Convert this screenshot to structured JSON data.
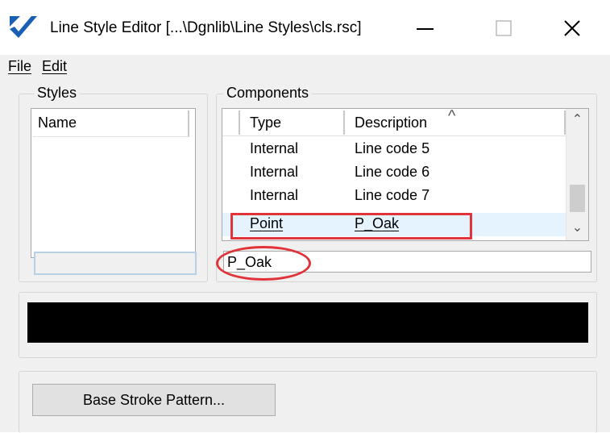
{
  "window": {
    "title": "Line Style Editor [...\\Dgnlib\\Line Styles\\cls.rsc]",
    "minimize_icon": "minimize-icon",
    "maximize_icon": "maximize-icon",
    "close_icon": "close-icon"
  },
  "menu": {
    "items": [
      {
        "label": "File"
      },
      {
        "label": "Edit"
      }
    ]
  },
  "styles": {
    "group_label": "Styles",
    "column_header": "Name"
  },
  "components": {
    "group_label": "Components",
    "columns": [
      "Type",
      "Description"
    ],
    "rows": [
      {
        "type": "Internal",
        "description": "Line code 5"
      },
      {
        "type": "Internal",
        "description": "Line code 6"
      },
      {
        "type": "Internal",
        "description": "Line code 7"
      },
      {
        "type": "Point",
        "description": "P_Oak"
      }
    ],
    "selected_index": 3,
    "description_value": "P_Oak"
  },
  "buttons": {
    "base_stroke": "Base Stroke Pattern..."
  },
  "colors": {
    "annotation": "#e0333a",
    "selection": "#e5f3ff",
    "preview": "#000000"
  }
}
